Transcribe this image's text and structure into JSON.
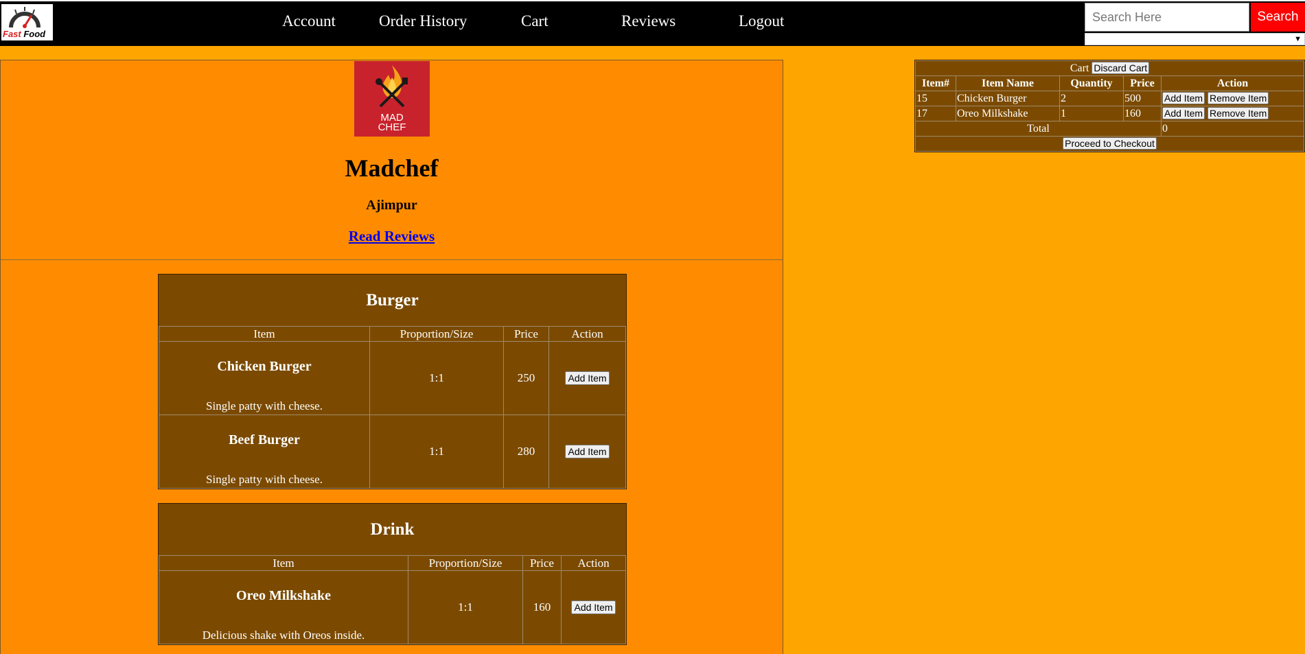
{
  "brand": {
    "logo_line1": "Fast",
    "logo_line2": "Food"
  },
  "nav": {
    "account": "Account",
    "order_history": "Order History",
    "cart": "Cart",
    "reviews": "Reviews",
    "logout": "Logout"
  },
  "search": {
    "placeholder": "Search Here",
    "button_label": "Search"
  },
  "restaurant": {
    "logo_text_1": "MAD",
    "logo_text_2": "CHEF",
    "name": "Madchef",
    "area": "Ajimpur",
    "reviews_link": "Read Reviews"
  },
  "menu": {
    "burger": {
      "title": "Burger",
      "headers": [
        "Item",
        "Proportion/Size",
        "Price",
        "Action"
      ],
      "items": [
        {
          "name": "Chicken Burger",
          "desc": "Single patty with cheese.",
          "size": "1:1",
          "price": "250",
          "action": "Add Item"
        },
        {
          "name": "Beef Burger",
          "desc": "Single patty with cheese.",
          "size": "1:1",
          "price": "280",
          "action": "Add Item"
        }
      ]
    },
    "drink": {
      "title": "Drink",
      "headers": [
        "Item",
        "Proportion/Size",
        "Price",
        "Action"
      ],
      "items": [
        {
          "name": "Oreo Milkshake",
          "desc": "Delicious shake with Oreos inside.",
          "size": "1:1",
          "price": "160",
          "action": "Add Item"
        }
      ]
    }
  },
  "cart": {
    "title": "Cart",
    "discard_label": "Discard Cart",
    "headers": [
      "Item#",
      "Item Name",
      "Quantity",
      "Price",
      "Action"
    ],
    "rows": [
      {
        "id": "15",
        "name": "Chicken Burger",
        "qty": "2",
        "price": "500",
        "add": "Add Item",
        "remove": "Remove Item"
      },
      {
        "id": "17",
        "name": "Oreo Milkshake",
        "qty": "1",
        "price": "160",
        "add": "Add Item",
        "remove": "Remove Item"
      }
    ],
    "total_label": "Total",
    "total_value": "0",
    "checkout_label": "Proceed to Checkout"
  },
  "colors": {
    "page_bg": "#ffa500",
    "panel_bg": "#ff8c00",
    "table_bg": "#7b4a00",
    "search_button": "#ff0000",
    "topbar": "#000000"
  }
}
